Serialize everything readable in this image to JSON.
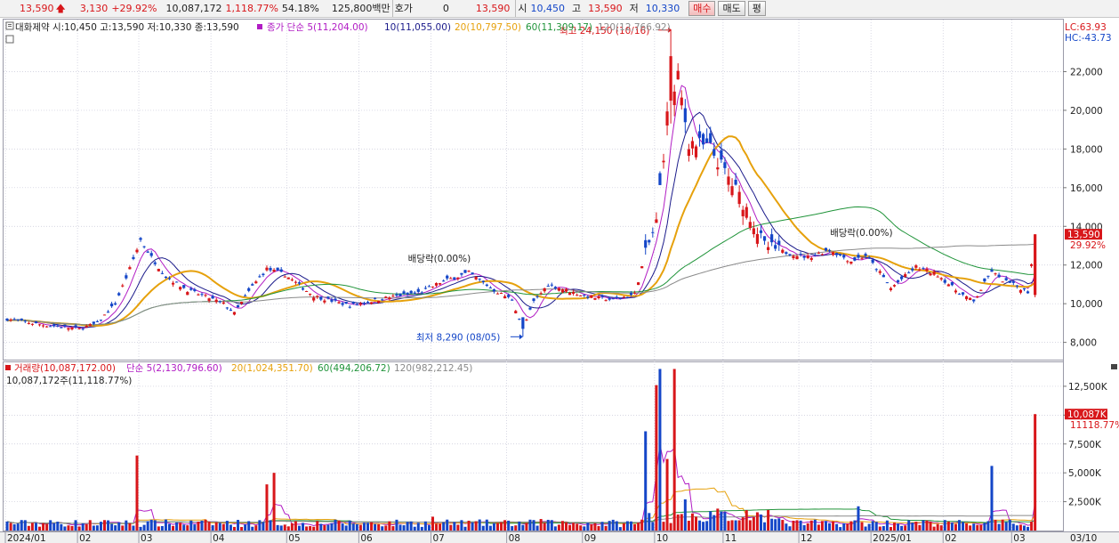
{
  "quote_bar": {
    "price": "13,590",
    "change": "3,130",
    "change_pct": "+29.92%",
    "volume": "10,087,172",
    "volume_ratio": "1,118.77%",
    "turnover_pct": "54.18%",
    "amount": "125,800백만",
    "hoga_label": "호가",
    "hoga_value": "0",
    "hoga_price": "13,590",
    "open_label": "시",
    "open_value": "10,450",
    "high_label": "고",
    "high_value": "13,590",
    "low_label": "저",
    "low_value": "10,330",
    "buy_label": "매수",
    "sell_label": "매도",
    "eval_label": "평"
  },
  "colors": {
    "up": "#d8161a",
    "down": "#1446c8",
    "ma5": "#b11cc4",
    "ma10": "#1a1a8a",
    "ma20": "#e6a10c",
    "ma60": "#20943a",
    "ma120": "#8a8a8a",
    "grid": "#c8c8d8"
  },
  "chart_data": [
    {
      "type": "candlestick",
      "stock_name": "대화제약",
      "ohlc_summary": {
        "open": "10,450",
        "high": "13,590",
        "low": "10,330",
        "close": "13,590"
      },
      "legend_text": "대화제약 시:10,450 고:13,590 저:10,330 종:13,590",
      "ma_legend": [
        {
          "name": "종가 단순 5(11,204.00)",
          "color": "#b11cc4"
        },
        {
          "name": "10(11,055.00)",
          "color": "#1a1a8a"
        },
        {
          "name": "20(10,797.50)",
          "color": "#e6a10c"
        },
        {
          "name": "60(11,309.17)",
          "color": "#20943a"
        },
        {
          "name": "120(12,766.92)",
          "color": "#8a8a8a"
        }
      ],
      "corner": {
        "lc": "LC:63.93",
        "hc": "HC:-43.73"
      },
      "y_ticks": [
        "22,000",
        "20,000",
        "18,000",
        "16,000",
        "14,000",
        "12,000",
        "10,000",
        "8,000"
      ],
      "y_tick_values": [
        22000,
        20000,
        18000,
        16000,
        14000,
        12000,
        10000,
        8000
      ],
      "ylim": [
        7200,
        24600
      ],
      "last_price_label": "13,590",
      "last_change_label": "29.92%",
      "last_price": 13590,
      "annotations": [
        {
          "text": "최고 24,150 (10/16)",
          "value": 24150,
          "date_index": 184
        },
        {
          "text": "최저 8,290 (08/05)",
          "value": 8290,
          "date_index": 143
        },
        {
          "text": "배당락(0.00%)",
          "date_index": 121
        },
        {
          "text": "배당락(0.00%)",
          "date_index": 238
        }
      ],
      "waypoints": [
        [
          0,
          9200
        ],
        [
          10,
          8900
        ],
        [
          20,
          8700
        ],
        [
          25,
          9000
        ],
        [
          30,
          10000
        ],
        [
          34,
          11800
        ],
        [
          37,
          13300
        ],
        [
          40,
          12400
        ],
        [
          44,
          11400
        ],
        [
          50,
          10700
        ],
        [
          56,
          10300
        ],
        [
          60,
          10000
        ],
        [
          63,
          9500
        ],
        [
          68,
          10900
        ],
        [
          72,
          11800
        ],
        [
          77,
          11500
        ],
        [
          85,
          10400
        ],
        [
          95,
          9900
        ],
        [
          105,
          10300
        ],
        [
          115,
          10600
        ],
        [
          120,
          11100
        ],
        [
          128,
          11600
        ],
        [
          135,
          10700
        ],
        [
          140,
          10200
        ],
        [
          143,
          8700
        ],
        [
          146,
          10100
        ],
        [
          150,
          11000
        ],
        [
          160,
          10400
        ],
        [
          168,
          10200
        ],
        [
          174,
          10500
        ],
        [
          177,
          12600
        ],
        [
          180,
          14200
        ],
        [
          183,
          19600
        ],
        [
          184,
          20000
        ],
        [
          186,
          21600
        ],
        [
          189,
          18400
        ],
        [
          195,
          18000
        ],
        [
          200,
          16500
        ],
        [
          205,
          14900
        ],
        [
          210,
          13000
        ],
        [
          215,
          12700
        ],
        [
          222,
          12400
        ],
        [
          228,
          12800
        ],
        [
          234,
          12200
        ],
        [
          238,
          12500
        ],
        [
          242,
          11600
        ],
        [
          245,
          10800
        ],
        [
          252,
          11900
        ],
        [
          258,
          11500
        ],
        [
          263,
          10700
        ],
        [
          268,
          10100
        ],
        [
          273,
          11700
        ],
        [
          275,
          11300
        ],
        [
          280,
          10900
        ],
        [
          283,
          10600
        ],
        [
          285,
          13590
        ]
      ],
      "x_labels": [
        "2024/01",
        "02",
        "03",
        "04",
        "05",
        "06",
        "07",
        "08",
        "09",
        "10",
        "11",
        "12",
        "2025/01",
        "02",
        "03",
        "03/10"
      ],
      "x_label_index": [
        0,
        20,
        37,
        57,
        78,
        98,
        118,
        139,
        160,
        180,
        199,
        220,
        240,
        260,
        279,
        290
      ]
    },
    {
      "type": "bar",
      "title": "거래량",
      "legend": [
        {
          "name": "거래량(10,087,172.00)",
          "color": "#d8161a"
        },
        {
          "name": "단순 5(2,130,796.60)",
          "color": "#b11cc4"
        },
        {
          "name": "20(1,024,351.70)",
          "color": "#e6a10c"
        },
        {
          "name": "60(494,206.72)",
          "color": "#20943a"
        },
        {
          "name": "120(982,212.45)",
          "color": "#8a8a8a"
        }
      ],
      "subtitle": "10,087,172주(11,118.77%)",
      "y_ticks": [
        "12,500K",
        "10,000K",
        "7,500K",
        "5,000K",
        "2,500K"
      ],
      "y_tick_values": [
        12500,
        10000,
        7500,
        5000,
        2500
      ],
      "ylim": [
        0,
        14500
      ],
      "last_volume_label": "10,087K",
      "last_ratio_label": "11118.77%",
      "spikes": [
        [
          36,
          6500
        ],
        [
          72,
          4000
        ],
        [
          74,
          5000
        ],
        [
          118,
          1200
        ],
        [
          148,
          1000
        ],
        [
          177,
          8600
        ],
        [
          180,
          12600
        ],
        [
          181,
          14000
        ],
        [
          183,
          6200
        ],
        [
          185,
          14000
        ],
        [
          188,
          2700
        ],
        [
          236,
          2100
        ],
        [
          273,
          5600
        ],
        [
          285,
          10087
        ]
      ],
      "base_volume": 300
    }
  ]
}
